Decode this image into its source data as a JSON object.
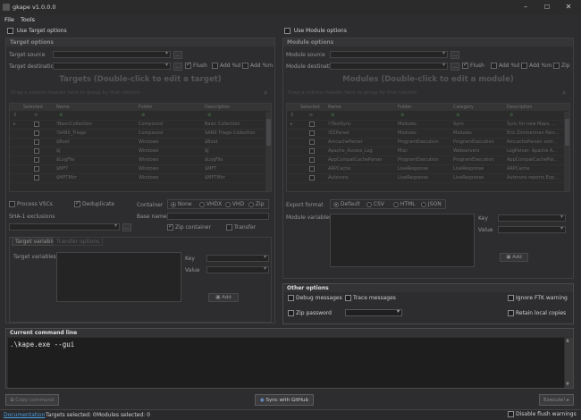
{
  "window": {
    "title": "gkape v1.0.0.0"
  },
  "menu": [
    "File",
    "Tools"
  ],
  "target": {
    "use_label": "Use Target options",
    "panel_title": "Target options",
    "source_label": "Target source",
    "dest_label": "Target destination",
    "flush_label": "Flush",
    "add_d_label": "Add %d",
    "add_m_label": "Add %m",
    "grid_title": "Targets (Double-click to edit a target)",
    "search_placeholder": "Drag a column header here to group by that column",
    "columns": [
      "Selected",
      "Name",
      "Folder",
      "Description"
    ],
    "rows": [
      [
        "!BasicCollection",
        "Compound",
        "Basic Collection"
      ],
      [
        "!SANS_Triage",
        "Compound",
        "SANS Triage Collection"
      ],
      [
        "$Boot",
        "Windows",
        "$Boot"
      ],
      [
        "$J",
        "Windows",
        "$J"
      ],
      [
        "$LogFile",
        "Windows",
        "$LogFile"
      ],
      [
        "$MFT",
        "Windows",
        "$MFT"
      ],
      [
        "$MFTMirr",
        "Windows",
        "$MFTMirr"
      ]
    ],
    "process_vscs": "Process VSCs",
    "deduplicate": "Deduplicate",
    "container_label": "Container",
    "container_options": [
      "None",
      "VHDX",
      "VHD",
      "Zip"
    ],
    "sha1_label": "SHA-1 exclusions",
    "basename_label": "Base name",
    "zip_container": "Zip container",
    "transfer": "Transfer",
    "tabs": [
      "Target variables",
      "Transfer options"
    ],
    "vars_label": "Target variables",
    "key_label": "Key",
    "value_label": "Value",
    "add_button": "Add"
  },
  "module": {
    "use_label": "Use Module options",
    "panel_title": "Module options",
    "source_label": "Module source",
    "dest_label": "Module destination",
    "flush_label": "Flush",
    "add_d_label": "Add %d",
    "add_m_label": "Add %m",
    "zip_label": "Zip",
    "grid_title": "Modules (Double-click to edit a module)",
    "search_placeholder": "Drag a column header here to group by that column",
    "columns": [
      "Selected",
      "Name",
      "Folder",
      "Category",
      "Description"
    ],
    "rows": [
      [
        "!!ToolSync",
        "Modules",
        "Sync",
        "Sync for new Maps, ..."
      ],
      [
        "!EZParser",
        "Modules",
        "Modules",
        "Eric Zimmerman Pars..."
      ],
      [
        "AmcacheParser",
        "ProgramExecution",
        "ProgramExecution",
        "AmcacheParser: extr..."
      ],
      [
        "Apache_Access_Log",
        "Misc",
        "Webservers",
        "LogParser: Apache A..."
      ],
      [
        "AppCompatCacheParser",
        "ProgramExecution",
        "ProgramExecution",
        "AppCompatCachePar..."
      ],
      [
        "ARPCache",
        "LiveResponse",
        "LiveResponse",
        "ARPCache"
      ],
      [
        "Autoruns",
        "LiveResponse",
        "LiveResponse",
        "Autoruns reports Exp..."
      ]
    ],
    "export_label": "Export format",
    "export_options": [
      "Default",
      "CSV",
      "HTML",
      "JSON"
    ],
    "vars_label": "Module variables",
    "key_label": "Key",
    "value_label": "Value",
    "add_button": "Add"
  },
  "other": {
    "title": "Other options",
    "debug": "Debug messages",
    "trace": "Trace messages",
    "ignore_ftk": "Ignore FTK warning",
    "zip_password": "Zip password",
    "retain": "Retain local copies"
  },
  "command": {
    "title": "Current command line",
    "text": ".\\kape.exe --gui"
  },
  "buttons": {
    "copy": "Copy command",
    "sync": "Sync with GitHub",
    "execute": "Execute!"
  },
  "status": {
    "documentation": "Documentation",
    "targets_selected": "Targets selected: 0",
    "modules_selected": "Modules selected: 0",
    "disable_flush": "Disable flush warnings"
  }
}
